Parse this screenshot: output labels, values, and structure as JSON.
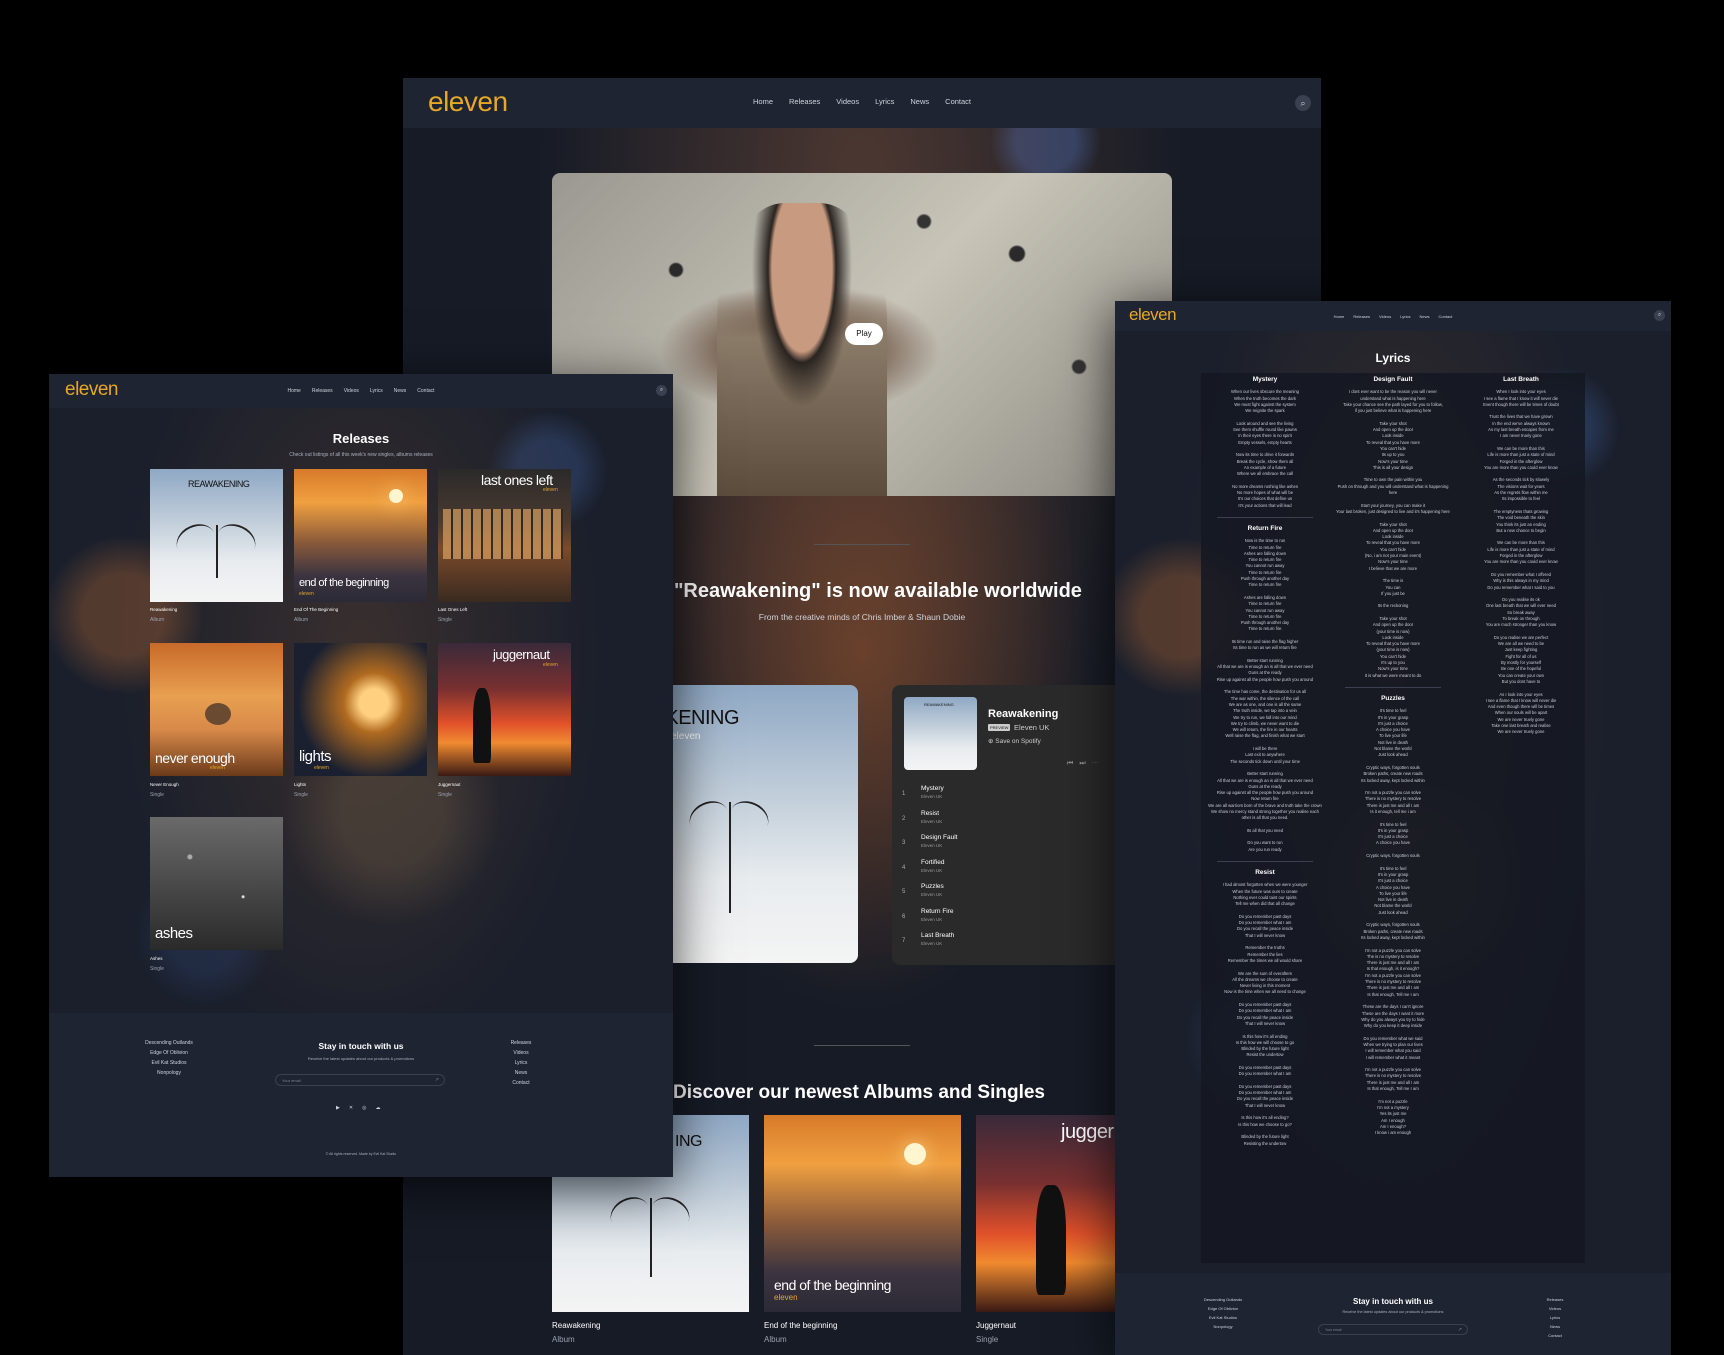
{
  "brand": {
    "logo": "eleven",
    "accent": "#e6a825",
    "bg": "#1a1f2b",
    "nav_bg": "#1f2433"
  },
  "nav": [
    "Home",
    "Releases",
    "Videos",
    "Lyrics",
    "News",
    "Contact"
  ],
  "home": {
    "play_label": "Play",
    "headline": "EP \"Reawakening\" is now available worldwide",
    "sub": "From the creative minds of Chris Imber & Shaun Dobie",
    "ep_cover_title": "REAWAKENING",
    "ep_cover_artist": "eleven",
    "player": {
      "title": "Reawakening",
      "badge": "PREVIEW",
      "artist": "Eleven UK",
      "save": "Save on Spotify",
      "cover_title": "REAWAKENING",
      "tracks": [
        {
          "n": "1",
          "t": "Mystery",
          "a": "Eleven UK"
        },
        {
          "n": "2",
          "t": "Resist",
          "a": "Eleven UK"
        },
        {
          "n": "3",
          "t": "Design Fault",
          "a": "Eleven UK"
        },
        {
          "n": "4",
          "t": "Fortified",
          "a": "Eleven UK"
        },
        {
          "n": "5",
          "t": "Puzzles",
          "a": "Eleven UK"
        },
        {
          "n": "6",
          "t": "Return Fire",
          "a": "Eleven UK"
        },
        {
          "n": "7",
          "t": "Last Breath",
          "a": "Eleven UK"
        }
      ]
    },
    "discover_title": "Discover our newest Albums and Singles",
    "discover": [
      {
        "art": "ING",
        "title": "Reawakening",
        "type": "Album"
      },
      {
        "art": "end of the beginning",
        "sub": "eleven",
        "title": "End of the beginning",
        "type": "Album"
      },
      {
        "art": "jugger",
        "title": "Juggernaut",
        "type": "Single"
      }
    ]
  },
  "releases": {
    "title": "Releases",
    "sub": "Check out listings of all this week's new singles, albums releases",
    "items": [
      {
        "art": "REAWAKENING",
        "sub": "",
        "title": "Reawakening",
        "type": "Album"
      },
      {
        "art": "end of the beginning",
        "sub": "eleven",
        "title": "End Of The Beginning",
        "type": "Album"
      },
      {
        "art": "last ones left",
        "sub": "eleven",
        "title": "Last Ones Left",
        "type": "Single"
      },
      {
        "art": "never enough",
        "sub": "eleven",
        "title": "Never Enough",
        "type": "Single"
      },
      {
        "art": "lights",
        "sub": "eleven",
        "title": "Lights",
        "type": "Single"
      },
      {
        "art": "juggernaut",
        "sub": "eleven",
        "title": "Juggernaut",
        "type": "Single"
      },
      {
        "art": "ashes",
        "sub": "",
        "title": "Ashes",
        "type": "Single"
      }
    ]
  },
  "footer": {
    "left": [
      "Descending Outlands",
      "Edge Of Oblivion",
      "Evil Kat Studios",
      "Nonpology"
    ],
    "title": "Stay in touch with us",
    "sub": "Receive the latest updates about our products & promotions",
    "email_placeholder": "Your email",
    "right": [
      "Releases",
      "Videos",
      "Lyrics",
      "News",
      "Contact"
    ],
    "social": [
      "youtube-icon",
      "x-icon",
      "instagram-icon",
      "soundcloud-icon"
    ],
    "copyright": "© All rights reserved. Made by Evil Kat Studio"
  },
  "lyrics": {
    "title": "Lyrics",
    "col1": [
      {
        "h": "Mystery",
        "l": [
          "When our lives obscure the meaning",
          "When the truth becomes the dark",
          "We must fight against the system",
          "We reignite the spark",
          "",
          "Look around and see the living",
          "See them shuffle round like pawns",
          "In their eyes there is no spirit",
          "Empty vessels, empty hearts",
          "",
          "Now its time to drive it forwards",
          "Break the cycle, show them all",
          "An example of a future",
          "Where we all embrace the call",
          "",
          "No more dreams rushing like ashes",
          "No more hopes of what will be",
          "It's our choices that define us",
          "It's your actions that will lead"
        ]
      },
      {
        "h": "Return Fire",
        "l": [
          "Now is the time to run",
          "Time to return fire",
          "Ashes are falling down",
          "Time to return fire",
          "You cannot run away",
          "Time to return fire",
          "Push through another day",
          "Time to return fire",
          "",
          "Ashes are falling down",
          "Time to return fire",
          "You cannot run away",
          "Time to return fire",
          "Push through another day",
          "Time to return fire",
          "",
          "Its time run and raise the flag higher",
          "Its time to run as we will return fire",
          "",
          "Better start running",
          "All that we are is enough an is all that we ever need",
          "Guns at the ready",
          "Rise up against all the people how push you around",
          "",
          "The time has come, the destination for us all",
          "The war within, the silence of the call",
          "We are as one, and one is all the same",
          "The truth inside, we tap into a vein",
          "We try to run, we fall into our mind",
          "We try to climb, we never want to die",
          "We will return, the fire in our hearts",
          "Well raise the flag, and finish what we start",
          "",
          "I will be there",
          "Last exit to anywhere",
          "The seconds tick down until your time",
          "",
          "Better start running",
          "All that we are is enough an is all that we ever need",
          "Guns at the ready",
          "Rise up against all the people how push you around",
          "Now return fire",
          "We are all warriors born of the brave and truth take the crown",
          "We show no mercy stand strong together you realise each other is all that you need.",
          "",
          "Its all that you need",
          "",
          "Do you want to run",
          "Are you run ready"
        ]
      },
      {
        "h": "Resist",
        "l": [
          "I had almost forgotten when we were younger",
          "When the future was ours to create",
          "Nothing ever could taint our spirits",
          "Tell me when did that all change",
          "",
          "Do you remember past days",
          "Do you remember what I am",
          "Do you recall the peace inside",
          "That I will never know",
          "",
          "Remember the truths",
          "Remember the lies",
          "Remember the times we all would share",
          "",
          "We are the sum of everafters",
          "All the dreams we choose to create",
          "Never living in this moment",
          "Now is the time when we all need to change",
          "",
          "Do you remember past days",
          "Do you remember what I am",
          "Do you recall the peace inside",
          "That I will never know",
          "",
          "Is this how it's all ending",
          "Is this how we will choose to go",
          "Blinded by the future light",
          "Resist the undertow",
          "",
          "Do you remember past days",
          "Do you remember what I am",
          "",
          "Do you remember past days",
          "Do you remember what I am",
          "Do you recall the peace inside",
          "That I will never know",
          "",
          "Is this how it's all ending?",
          "Is this how we choose to go?",
          "",
          "Blinded by the future light",
          "Resisting the undertow"
        ]
      }
    ],
    "col2": [
      {
        "h": "Design Fault",
        "l": [
          "I dont ever want to be the reason you will never",
          "understand what is happening here",
          "Take your chance see the path layed for you to follow,",
          "if you just believe what is happening here",
          "",
          "Take your shot",
          "And open up the door",
          "Look inside",
          "To reveal that you have more",
          "You can't hide",
          "Its up to you",
          "Now's your time",
          "This is all your design",
          "",
          "Time to own the pain within you",
          "Push on through and you will understand what is happening here",
          "",
          "Start your journey, you can make it",
          "Your last broken, just designed to live and it's happening here",
          "",
          "Take your shot",
          "And open up the door",
          "Look inside",
          "To reveal that you have more",
          "You can't hide",
          "(No, i am not your main event)",
          "Now's your time",
          "I believe that we are more",
          "",
          "The time is",
          "You can",
          "If you just be",
          "",
          "Its the reckoning",
          "",
          "Take your shot",
          "And open up the door",
          "(your time is now)",
          "Look inside",
          "To reveal that you have more",
          "(your time is now)",
          "You can't hide",
          "It's up to you",
          "Now's your time",
          "It is what we were meant to do"
        ]
      },
      {
        "h": "Puzzles",
        "l": [
          "It's time to feel",
          "It's in your grasp",
          "It's just a choice",
          "A choice you have",
          "To live your life",
          "Not live in death",
          "Not blame the world",
          "Just look ahead",
          "",
          "Cryptic ways, forgotten souls",
          "Broken paths, create new roads",
          "Its locked away, kept locked within",
          "",
          "I'm not a puzzle you can solve",
          "There is no mystery to resolve",
          "There is just me and all I am",
          "Is it enough, tell me i am",
          "",
          "It's time to feel",
          "It's in your grasp",
          "It's just a choice",
          "A choice you have",
          "",
          "Cryptic ways, forgotten souls",
          "",
          "It's time to feel",
          "It's in your grasp",
          "It's just a choice",
          "A choice you have",
          "To live your life",
          "Not live in death",
          "Not blame the world",
          "Just look ahead",
          "",
          "Cryptic ways, forgotten souls",
          "Broken paths, create new roads",
          "Its locked away, kept locked within",
          "",
          "I'm not a puzzle you can solve",
          "The is no mystery to resolve",
          "There is just me and all I am",
          "Is that enough, is it enough?",
          "I'm not a puzzle you can solve",
          "There is no mystery to resolve",
          "There is just me and all I am",
          "Is that enough, Tell me I am",
          "",
          "These are the days I can't ignore",
          "These are the days I want it more",
          "Why do you always you try to hide",
          "Why do you keep it deep inside",
          "",
          "Do you remember what we said",
          "When we trying to plan our lives",
          "I will remember what you said",
          "I will remember what it meant",
          "",
          "I'm not a puzzle you can solve",
          "There is no mystery to resolve",
          "There is just me and all I am",
          "Is that enough, Tell me I am",
          "",
          "I'm not a puzzle",
          "I'm not a mystery",
          "Yes its just me",
          "Am I enough",
          "Am I enough?",
          "I know i am enough"
        ]
      }
    ],
    "col3": [
      {
        "h": "Last Breath",
        "l": [
          "When I look into your eyes",
          "I see a flame that I know it will never die",
          "Event though there will be times of doubt",
          "",
          "Trust the lives that we have grown",
          "In the end we've always known",
          "As my last breath escapes from me",
          "I am never truely gone",
          "",
          "We can be more than this",
          "Life is more than just a state of mind",
          "Forged in the afterglow",
          "You are more than you could ever know",
          "",
          "As the seconds tick by slowely",
          "The visions wait for years",
          "As the regrets flow within me",
          "Its impossible to feel",
          "",
          "The emptyness thats growing",
          "The void beneath the skin",
          "You think its just an ending",
          "But a new chance to begin",
          "",
          "We can be more than this",
          "Life is more than just a state of mind",
          "Forged in the afterglow",
          "You are more than you could ever know",
          "",
          "Do you remember what I offered",
          "Why is this always in my mind",
          "Do you remember what I said to you",
          "",
          "Do you realise its ok",
          "One last breath that we will ever need",
          "So break away",
          "To break on through",
          "You are much stronger than you know",
          "",
          "Do you realise we are perfect",
          "We are all we need to be",
          "Just keep fighting",
          "Fight for all of us",
          "By mostly for yourself",
          "Be one of the hopeful",
          "You can create your own",
          "But you dont have to",
          "",
          "As I look into your eyes",
          "I see a flame that I know will never die",
          "And even though there will be times",
          "When our souls will be apart",
          "We are never truely gone",
          "Take one last breath and realise",
          "We are never truely gone"
        ]
      }
    ]
  }
}
